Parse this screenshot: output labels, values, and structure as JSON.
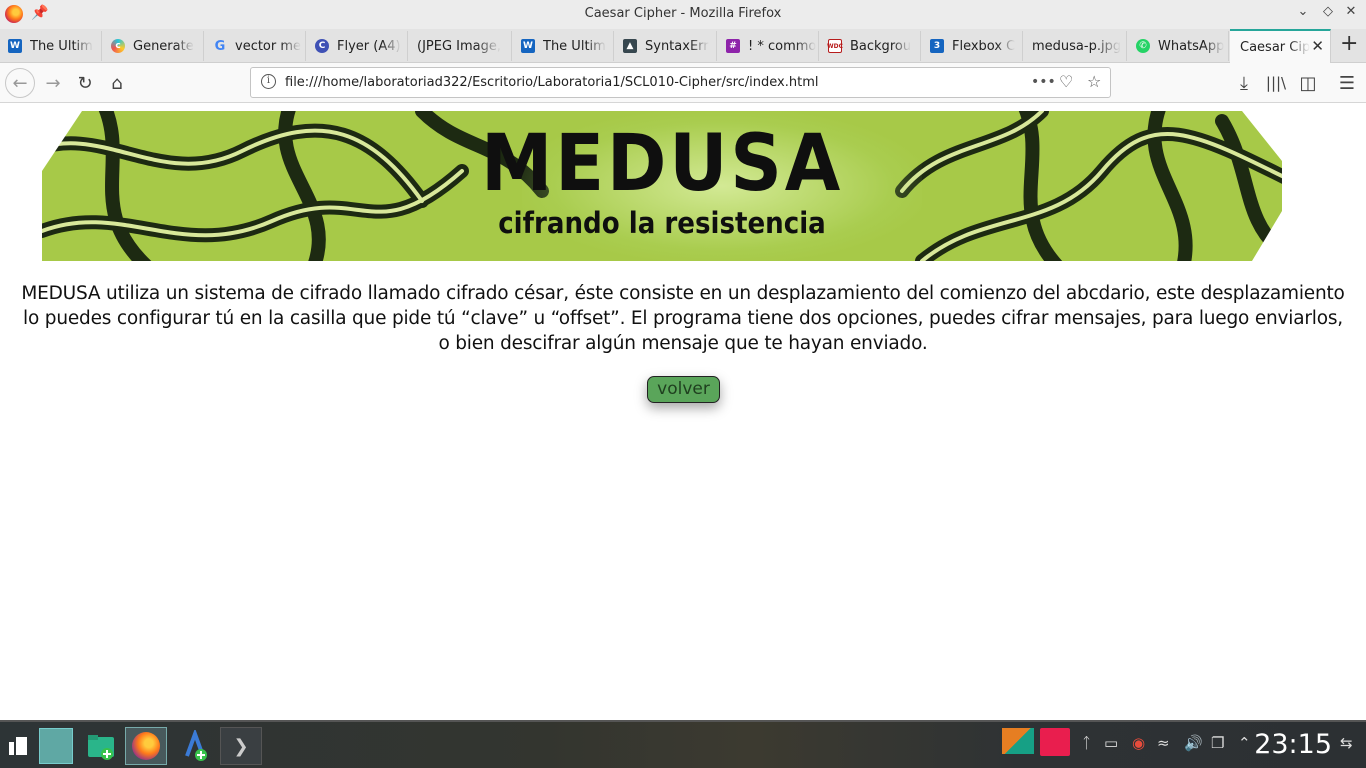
{
  "window": {
    "title": "Caesar Cipher - Mozilla Firefox"
  },
  "tabs": [
    {
      "label": "The Ultim",
      "icon": "wordpress-icon",
      "color": "#1565c0"
    },
    {
      "label": "Generate",
      "icon": "colorful-c-icon",
      "color": "#26c6da"
    },
    {
      "label": "vector me",
      "icon": "google-icon",
      "color": "#4285f4"
    },
    {
      "label": "Flyer (A4)",
      "icon": "c-circle-icon",
      "color": "#3f51b5"
    },
    {
      "label": "(JPEG Image,",
      "icon": "none",
      "color": ""
    },
    {
      "label": "The Ultim",
      "icon": "wordpress-icon",
      "color": "#1565c0"
    },
    {
      "label": "SyntaxErr",
      "icon": "mortarboard-icon",
      "color": "#37474f"
    },
    {
      "label": "! * commo",
      "icon": "slack-icon",
      "color": "#8e24aa"
    },
    {
      "label": "Backgrou",
      "icon": "wdc-icon",
      "color": "#b71c1c"
    },
    {
      "label": "Flexbox C",
      "icon": "css3-icon",
      "color": "#1565c0"
    },
    {
      "label": "medusa-p.jpg",
      "icon": "none",
      "color": ""
    },
    {
      "label": "WhatsApp",
      "icon": "whatsapp-icon",
      "color": "#25d366"
    },
    {
      "label": "Caesar Cip",
      "icon": "none",
      "color": "",
      "active": true
    }
  ],
  "navbar": {
    "url": "file:///home/laboratoriad322/Escritorio/Laboratoria1/SCL010-Cipher/src/index.html"
  },
  "page": {
    "banner_title": "MEDUSA",
    "banner_subtitle": "cifrando la resistencia",
    "description": "MEDUSA utiliza un sistema de cifrado llamado cifrado césar, éste consiste en un desplazamiento del comienzo del abcdario, este desplazamiento lo puedes configurar tú en la casilla que pide tú “clave” u “offset”. El programa tiene dos opciones, puedes cifrar mensajes, para luego enviarlos, o bien descifrar algún mensaje que te hayan enviado.",
    "back_button": "volver"
  },
  "taskbar": {
    "clock": "23:15"
  },
  "colors": {
    "accent_tab": "#26a69a",
    "button_green": "#5aa55a",
    "banner_green": "#a7c948"
  }
}
